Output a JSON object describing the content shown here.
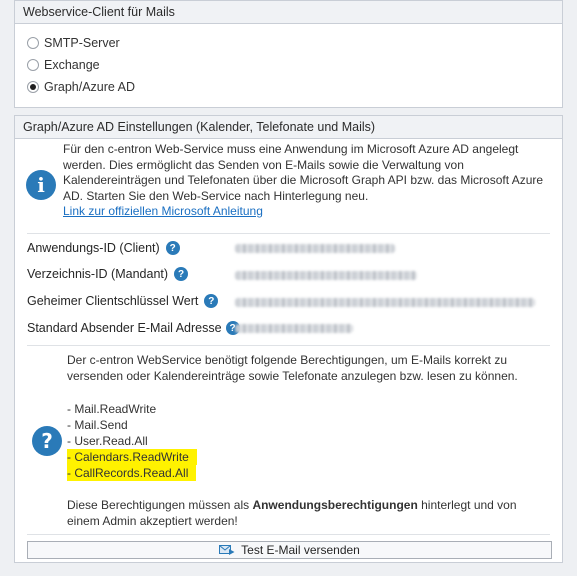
{
  "webservice_panel": {
    "title": "Webservice-Client für Mails",
    "options": [
      {
        "label": "SMTP-Server",
        "selected": false
      },
      {
        "label": "Exchange",
        "selected": false
      },
      {
        "label": "Graph/Azure AD",
        "selected": true
      }
    ]
  },
  "graph_panel": {
    "title": "Graph/Azure AD Einstellungen (Kalender, Telefonate und Mails)",
    "intro": "Für den c-entron Web-Service muss eine Anwendung im Microsoft Azure AD angelegt werden. Dies ermöglicht das Senden von E-Mails sowie die Verwaltung von Kalendereinträgen und Telefonaten über die Microsoft Graph API bzw. das Microsoft Azure AD. Starten Sie den Web-Service nach Hinterlegung neu.",
    "link": "Link zur offiziellen Microsoft Anleitung",
    "fields": {
      "app_id": "Anwendungs-ID (Client)",
      "tenant_id": "Verzeichnis-ID (Mandant)",
      "secret": "Geheimer Clientschlüssel Wert",
      "sender": "Standard Absender E-Mail Adresse"
    },
    "perm_intro": "Der c-entron WebService benötigt folgende Berechtigungen, um E-Mails korrekt zu versenden oder Kalendereinträge sowie Telefonate anzulegen bzw. lesen zu können.",
    "permissions": [
      "- Mail.ReadWrite",
      "- Mail.Send",
      "- User.Read.All",
      "- Calendars.ReadWrite",
      "- CallRecords.Read.All"
    ],
    "perm_note_pre": "Diese Berechtigungen müssen als ",
    "perm_note_bold": "Anwendungsberechtigungen",
    "perm_note_post": " hinterlegt und von einem Admin akzeptiert werden!",
    "test_button": "Test E-Mail versenden"
  },
  "icons": {
    "info": "info-icon",
    "help": "question-icon",
    "mail": "mail-send-icon"
  },
  "colors": {
    "accent": "#2a7ab8",
    "link": "#1a6fc2",
    "highlight": "#fff200"
  }
}
